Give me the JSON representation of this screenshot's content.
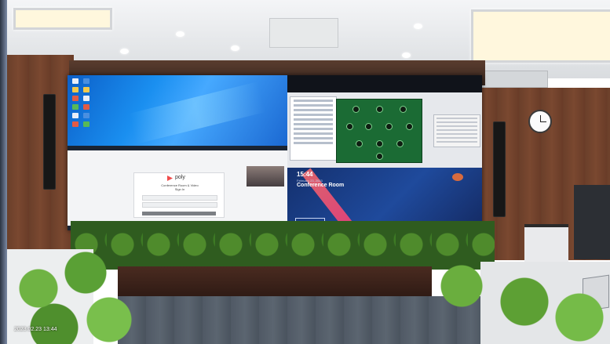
{
  "photo": {
    "scene": "conference-room-video-wall",
    "watermark": "2023.02.23 13:44"
  },
  "video_wall": {
    "conference_screen": {
      "time": "15:44",
      "date": "February 23, 2023",
      "room_name": "Conference Room"
    },
    "login_screen": {
      "brand": "poly",
      "title": "Conference Room & Video",
      "subtitle": "Sign In"
    }
  },
  "colors": {
    "wood": "#6a3f2a",
    "screen_blue": "#1a8ff0",
    "conference_bg": "#1f4a9c",
    "accent_red": "#ff2b7a",
    "foliage": "#5aa035"
  }
}
